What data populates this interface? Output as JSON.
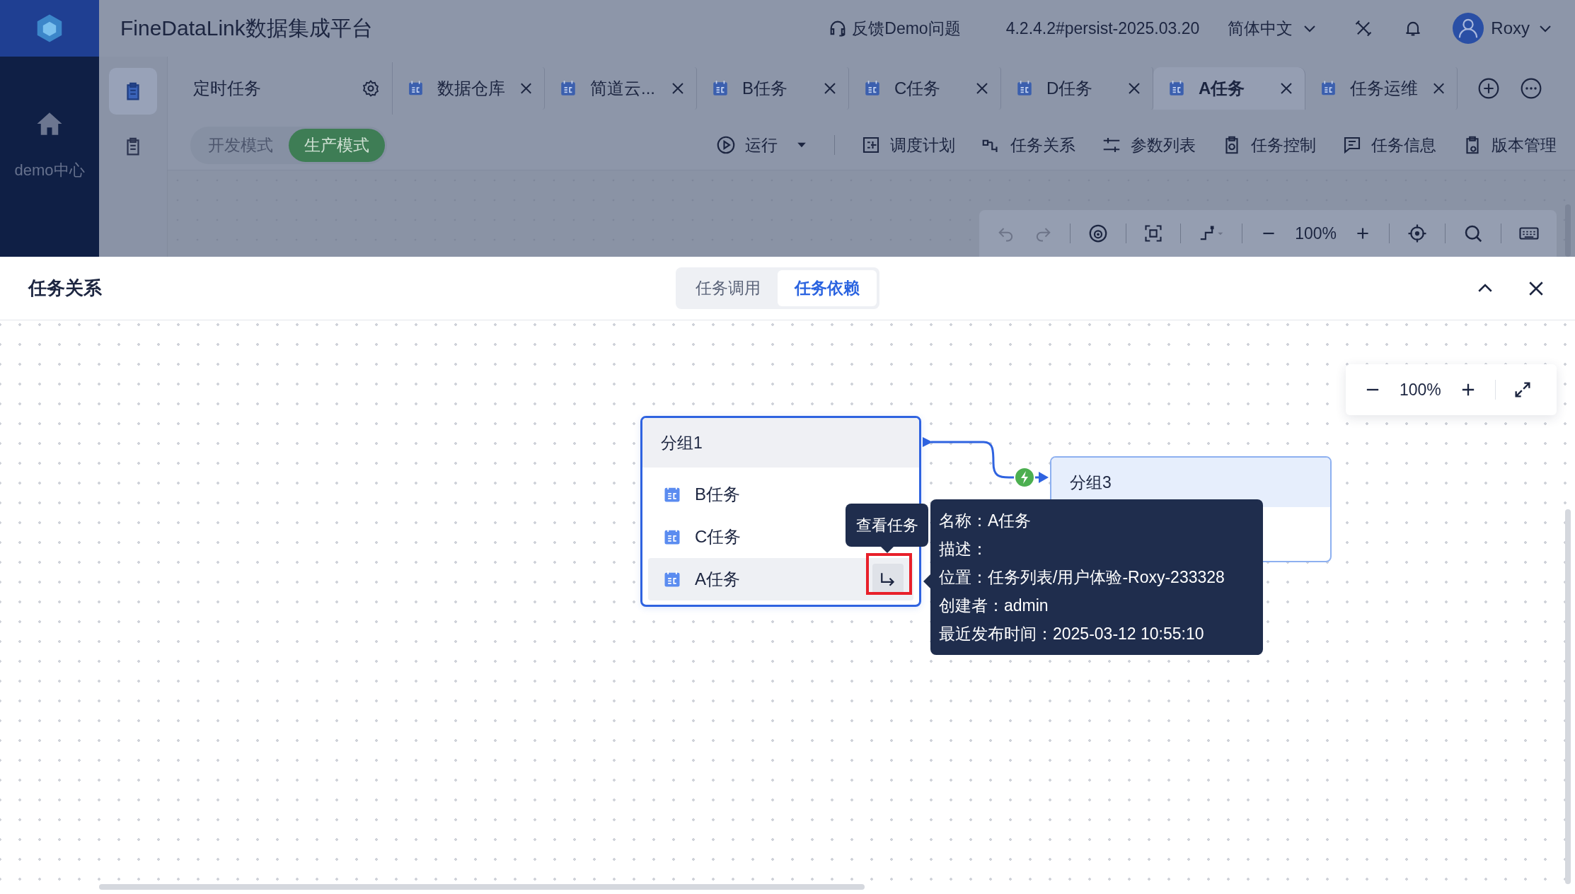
{
  "app": {
    "title": "FineDataLink数据集成平台",
    "feedback": "反馈Demo问题",
    "version": "4.2.4.2#persist-2025.03.20",
    "language": "简体中文",
    "user": "Roxy"
  },
  "sidebar": {
    "items": [
      {
        "label": "demo中心"
      }
    ]
  },
  "module_rail": [
    {
      "selected": true
    },
    {
      "selected": false
    }
  ],
  "tabs": [
    {
      "label": "定时任务",
      "kind": "root",
      "selected": false
    },
    {
      "label": "数据仓库",
      "kind": "task",
      "selected": false
    },
    {
      "label": "简道云...",
      "kind": "task",
      "selected": false
    },
    {
      "label": "B任务",
      "kind": "task",
      "selected": false
    },
    {
      "label": "C任务",
      "kind": "task",
      "selected": false
    },
    {
      "label": "D任务",
      "kind": "task",
      "selected": false
    },
    {
      "label": "A任务",
      "kind": "task",
      "selected": true
    },
    {
      "label": "任务运维",
      "kind": "task",
      "selected": false
    }
  ],
  "modes": [
    {
      "label": "开发模式",
      "selected": false
    },
    {
      "label": "生产模式",
      "selected": true
    }
  ],
  "toolbar": [
    {
      "label": "运行",
      "kind": "dropdown"
    },
    {
      "label": "调度计划",
      "kind": "plain"
    },
    {
      "label": "任务关系",
      "kind": "plain"
    },
    {
      "label": "参数列表",
      "kind": "plain"
    },
    {
      "label": "任务控制",
      "kind": "plain"
    },
    {
      "label": "任务信息",
      "kind": "plain"
    },
    {
      "label": "版本管理",
      "kind": "plain"
    }
  ],
  "canvas_toolbar": {
    "zoom": "100%"
  },
  "panel": {
    "title": "任务关系",
    "tabs": [
      {
        "label": "任务调用",
        "selected": false
      },
      {
        "label": "任务依赖",
        "selected": true
      }
    ],
    "zoom": "100%",
    "groups": [
      {
        "title": "分组1",
        "selected": true,
        "tasks": [
          {
            "name": "B任务",
            "hovered": false
          },
          {
            "name": "C任务",
            "hovered": false
          },
          {
            "name": "A任务",
            "hovered": true
          }
        ]
      },
      {
        "title": "分组3",
        "selected": false
      }
    ],
    "action_tooltip": "查看任务",
    "info_tooltip": [
      "名称：A任务",
      "描述：",
      "位置：任务列表/用户体验-Roxy-233328",
      "创建者：admin",
      "最近发布时间：2025-03-12 10:55:10"
    ]
  }
}
